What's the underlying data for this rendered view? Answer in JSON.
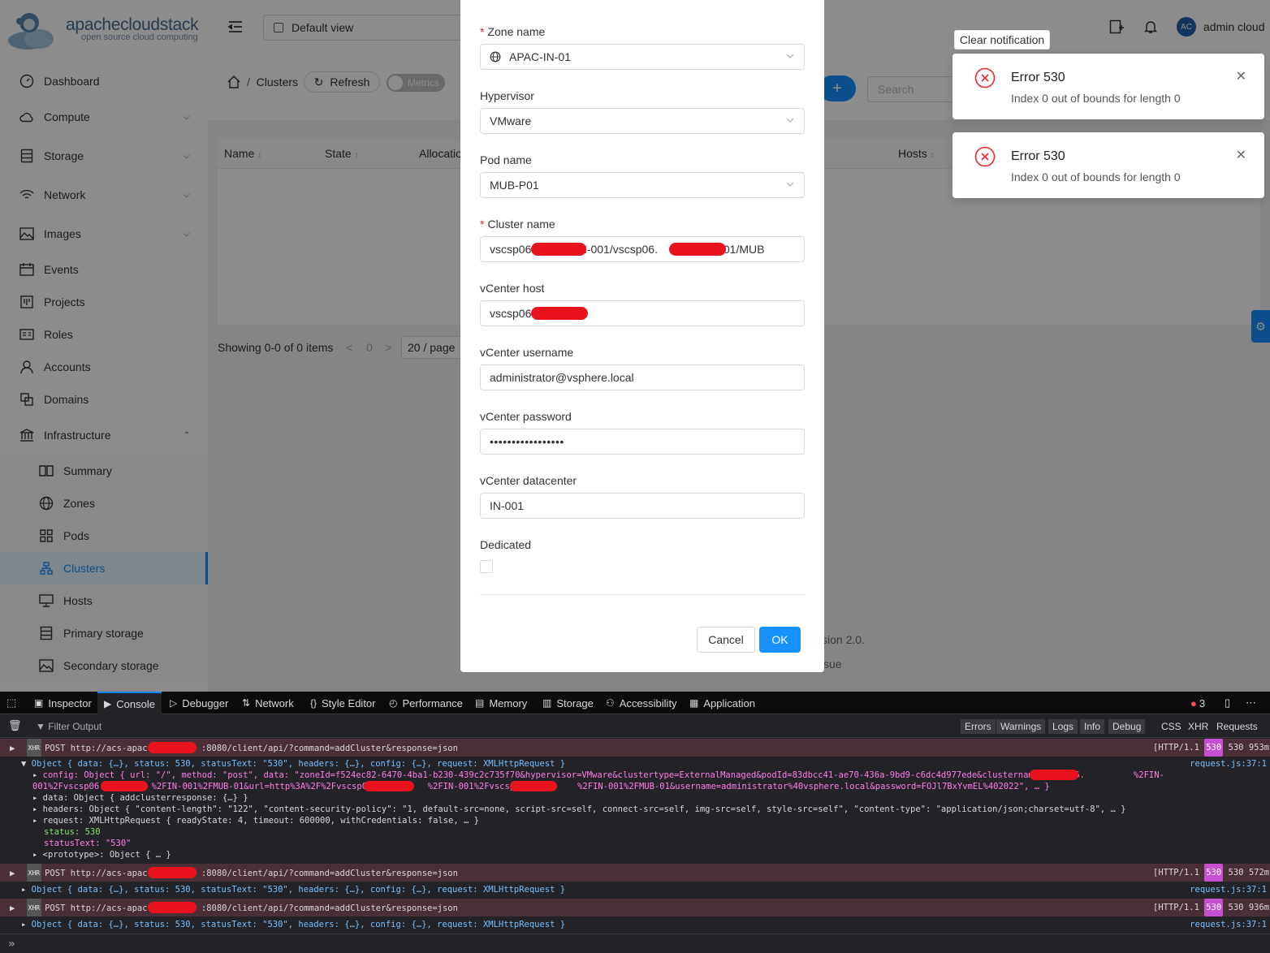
{
  "header": {
    "logo_name": "apachecloudstack",
    "logo_tagline": "open source cloud computing",
    "view_select": "Default view",
    "avatar_initials": "AC",
    "user_name": "admin cloud",
    "clear_notification": "Clear notification"
  },
  "sidebar": {
    "items": [
      {
        "label": "Dashboard",
        "icon": "dashboard-icon"
      },
      {
        "label": "Compute",
        "icon": "cloud-icon"
      },
      {
        "label": "Storage",
        "icon": "database-icon"
      },
      {
        "label": "Network",
        "icon": "wifi-icon"
      },
      {
        "label": "Images",
        "icon": "picture-icon"
      },
      {
        "label": "Events",
        "icon": "calendar-icon"
      },
      {
        "label": "Projects",
        "icon": "project-icon"
      },
      {
        "label": "Roles",
        "icon": "idcard-icon"
      },
      {
        "label": "Accounts",
        "icon": "user-icon"
      },
      {
        "label": "Domains",
        "icon": "block-icon"
      },
      {
        "label": "Infrastructure",
        "icon": "bank-icon"
      }
    ],
    "infra_items": [
      {
        "label": "Summary",
        "icon": "read-icon"
      },
      {
        "label": "Zones",
        "icon": "global-icon"
      },
      {
        "label": "Pods",
        "icon": "appstore-icon"
      },
      {
        "label": "Clusters",
        "icon": "cluster-icon"
      },
      {
        "label": "Hosts",
        "icon": "desktop-icon"
      },
      {
        "label": "Primary storage",
        "icon": "hdd-icon"
      },
      {
        "label": "Secondary storage",
        "icon": "picture-icon"
      }
    ]
  },
  "main": {
    "breadcrumb": "Clusters",
    "refresh": "Refresh",
    "metrics": "Metrics",
    "search_placeholder": "Search",
    "columns": [
      "Name",
      "State",
      "Allocatio",
      "Hosts"
    ],
    "showing": "Showing 0-0 of 0 items",
    "page_num": "0",
    "page_size": "20 / page",
    "footer_version": "sion 2.0.",
    "footer_issue": "sue"
  },
  "modal": {
    "zone_label": "Zone name",
    "zone_value": "APAC-IN-01",
    "hypervisor_label": "Hypervisor",
    "hypervisor_value": "VMware",
    "pod_label": "Pod name",
    "pod_value": "MUB-P01",
    "cluster_label": "Cluster name",
    "cluster_value": "vscsp06.            /IN-001/vscsp06.             /IN-001/MUB",
    "vcenter_host_label": "vCenter host",
    "vcenter_host_value": "vscsp06.",
    "vcenter_user_label": "vCenter username",
    "vcenter_user_value": "administrator@vsphere.local",
    "vcenter_pass_label": "vCenter password",
    "vcenter_pass_value": "•••••••••••••••••",
    "vcenter_dc_label": "vCenter datacenter",
    "vcenter_dc_value": "IN-001",
    "dedicated_label": "Dedicated",
    "cancel": "Cancel",
    "ok": "OK"
  },
  "notifications": [
    {
      "title": "Error 530",
      "desc": "Index 0 out of bounds for length 0"
    },
    {
      "title": "Error 530",
      "desc": "Index 0 out of bounds for length 0"
    }
  ],
  "devtools": {
    "tabs": [
      "Inspector",
      "Console",
      "Debugger",
      "Network",
      "Style Editor",
      "Performance",
      "Memory",
      "Storage",
      "Accessibility",
      "Application"
    ],
    "error_count": "3",
    "filter_placeholder": "Filter Output",
    "filters": [
      "Errors",
      "Warnings",
      "Logs",
      "Info",
      "Debug",
      "CSS",
      "XHR",
      "Requests"
    ],
    "xhr_badge": "XHR",
    "post_prefix": "POST http://acs-apac.",
    "post_suffix": ":8080/client/api/?command=addCluster&response=json",
    "http": "[HTTP/1.1",
    "status_code": "530",
    "timings": [
      "530 953ms",
      "530 572ms",
      "530 936ms"
    ],
    "object_line": "Object { data: {…}, status: 530, statusText: \"530\", headers: {…}, config: {…}, request: XMLHttpRequest }",
    "config_line1": "config: Object { url: \"/\", method: \"post\", data: \"zoneId=f524ec82-6470-4ba1-b230-439c2c735f70&hypervisor=VMware&clustertype=ExternalManaged&podId=83dbcc41-ae70-436a-9bd9-c6dc4d977ede&clustername=vscsp06.",
    "config_line1_end": "%2FIN-",
    "config_line2a": "001%2Fvscsp06.",
    "config_line2b": "%2FIN-001%2FMUB-01&url=http%3A%2F%2Fvscsp06.",
    "config_line2c": "%2FIN-001%2Fvscsp06.",
    "config_line2d": "%2FIN-001%2FMUB-01&username=administrator%40vsphere.local&password=FOJl7BxYvmEL%402022\", … }",
    "data_line": "data: Object { addclusterresponse: {…} }",
    "headers_line": "headers: Object { \"content-length\": \"122\", \"content-security-policy\": \"1, default-src=none, script-src=self, connect-src=self, img-src=self, style-src=self\", \"content-type\": \"application/json;charset=utf-8\", … }",
    "request_line": "request: XMLHttpRequest { readyState: 4, timeout: 600000, withCredentials: false, … }",
    "status_line": "status: 530",
    "statustext_line": "statusText: \"530\"",
    "prototype_line": "<prototype>: Object { … }",
    "source": "request.js:37:1"
  }
}
